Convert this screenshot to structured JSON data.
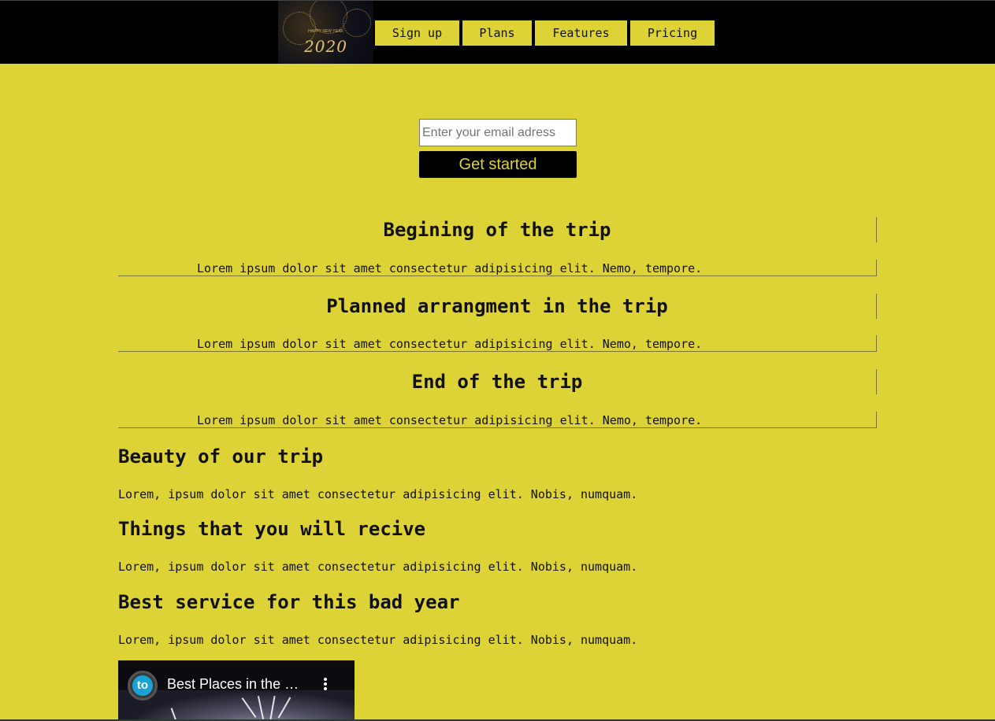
{
  "header": {
    "logo": {
      "icon": "new-year-2020-fireworks-logo",
      "year_text": "2020",
      "small_text": "HAPPY NEW YEAR"
    },
    "nav": [
      {
        "label": "Sign up"
      },
      {
        "label": "Plans"
      },
      {
        "label": "Features"
      },
      {
        "label": "Pricing"
      }
    ]
  },
  "form": {
    "email_placeholder": "Enter your email adress",
    "email_value": "",
    "button_label": "Get started"
  },
  "timeline": [
    {
      "heading": "Begining of the trip",
      "text": "Lorem ipsum dolor sit amet consectetur adipisicing elit. Nemo, tempore."
    },
    {
      "heading": "Planned arrangment in the trip",
      "text": "Lorem ipsum dolor sit amet consectetur adipisicing elit. Nemo, tempore."
    },
    {
      "heading": "End of the trip",
      "text": "Lorem ipsum dolor sit amet consectetur adipisicing elit. Nemo, tempore."
    }
  ],
  "features": [
    {
      "heading": "Beauty of our trip",
      "text": "Lorem, ipsum dolor sit amet consectetur adipisicing elit. Nobis, numquam."
    },
    {
      "heading": "Things that you will recive",
      "text": "Lorem, ipsum dolor sit amet consectetur adipisicing elit. Nobis, numquam."
    },
    {
      "heading": "Best service for this bad year",
      "text": "Lorem, ipsum dolor sit amet consectetur adipisicing elit. Nobis, numquam."
    }
  ],
  "video": {
    "title": "Best Places in the World to Celebrate New Year",
    "channel_icon": "channel-avatar-icon",
    "channel_initials": "to",
    "menu_icon": "more-vert-icon"
  },
  "colors": {
    "background": "#ddd236",
    "header": "#000000",
    "button_text": "#ddd236"
  }
}
